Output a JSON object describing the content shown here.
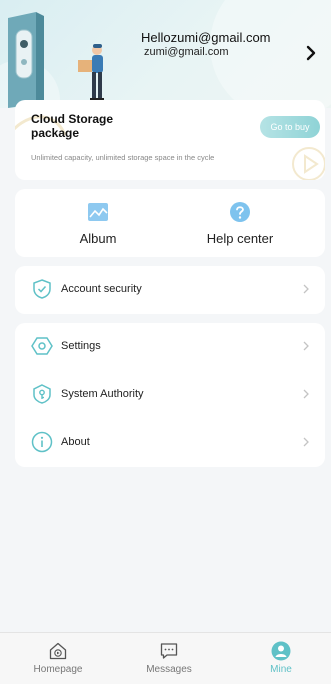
{
  "profile": {
    "email_main": "Hellozumi@gmail.com",
    "email_sub": "zumi@gmail.com"
  },
  "cloud": {
    "title": "Cloud Storage package",
    "description": "Unlimited capacity, unlimited storage space in the cycle",
    "button": "Go to buy"
  },
  "quick": {
    "album": "Album",
    "help": "Help center"
  },
  "menu": {
    "account_security": "Account security",
    "settings": "Settings",
    "system_authority": "System Authority",
    "about": "About"
  },
  "tabs": [
    {
      "label": "Homepage",
      "icon": "home-icon",
      "active": false
    },
    {
      "label": "Messages",
      "icon": "messages-icon",
      "active": false
    },
    {
      "label": "Mine",
      "icon": "person-icon",
      "active": true
    }
  ],
  "colors": {
    "accent": "#5fc1c7",
    "header_bg": "#e1f1f3",
    "page_bg": "#f4f6f8"
  }
}
